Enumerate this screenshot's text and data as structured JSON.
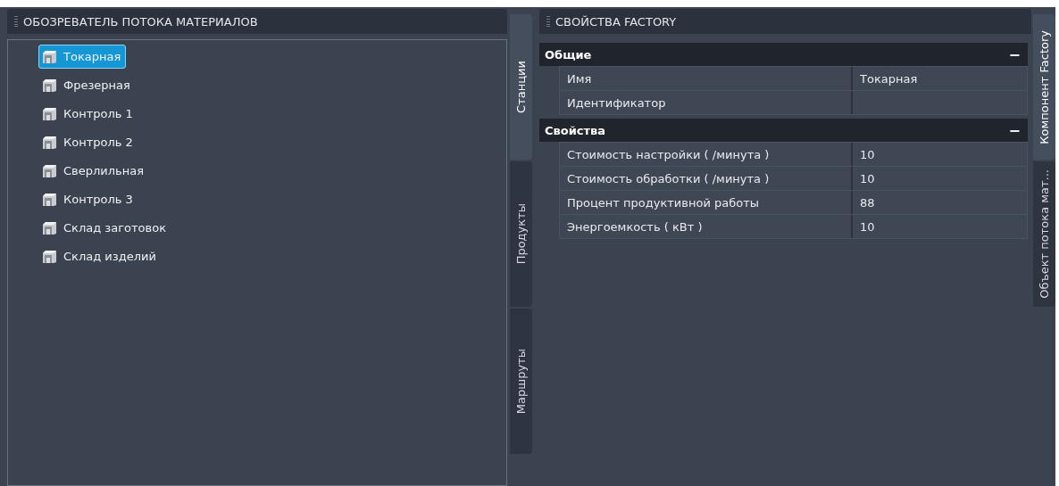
{
  "explorer": {
    "title": "ОБОЗРЕВАТЕЛЬ ПОТОКА МАТЕРИАЛОВ",
    "items": [
      {
        "label": "Токарная",
        "selected": true
      },
      {
        "label": "Фрезерная",
        "selected": false
      },
      {
        "label": "Контроль 1",
        "selected": false
      },
      {
        "label": "Контроль 2",
        "selected": false
      },
      {
        "label": "Сверлильная",
        "selected": false
      },
      {
        "label": "Контроль 3",
        "selected": false
      },
      {
        "label": "Склад заготовок",
        "selected": false
      },
      {
        "label": "Склад изделий",
        "selected": false
      }
    ],
    "tabs": [
      {
        "label": "Станции",
        "selected": true
      },
      {
        "label": "Продукты",
        "selected": false
      },
      {
        "label": "Маршруты",
        "selected": false
      }
    ]
  },
  "properties": {
    "title": "СВОЙСТВА FACTORY",
    "sections": [
      {
        "title": "Общие",
        "toggle": "−",
        "expanded": true,
        "rows": [
          {
            "name": "Имя",
            "value": "Токарная"
          },
          {
            "name": "Идентификатор"
          }
        ]
      },
      {
        "title": "Свойства",
        "toggle": "−",
        "expanded": true,
        "rows": [
          {
            "name": "Стоимость настройки ( /минута )",
            "value": "10"
          },
          {
            "name": "Стоимость обработки ( /минута )",
            "value": "10"
          },
          {
            "name": "Процент продуктивной работы",
            "value": "88"
          },
          {
            "name": "Энергоемкость ( кВт )",
            "value": "10"
          }
        ]
      }
    ],
    "tabs": [
      {
        "label": "Компонент Factory",
        "selected": true
      },
      {
        "label": "Объект потока мат...",
        "selected": false
      }
    ]
  }
}
